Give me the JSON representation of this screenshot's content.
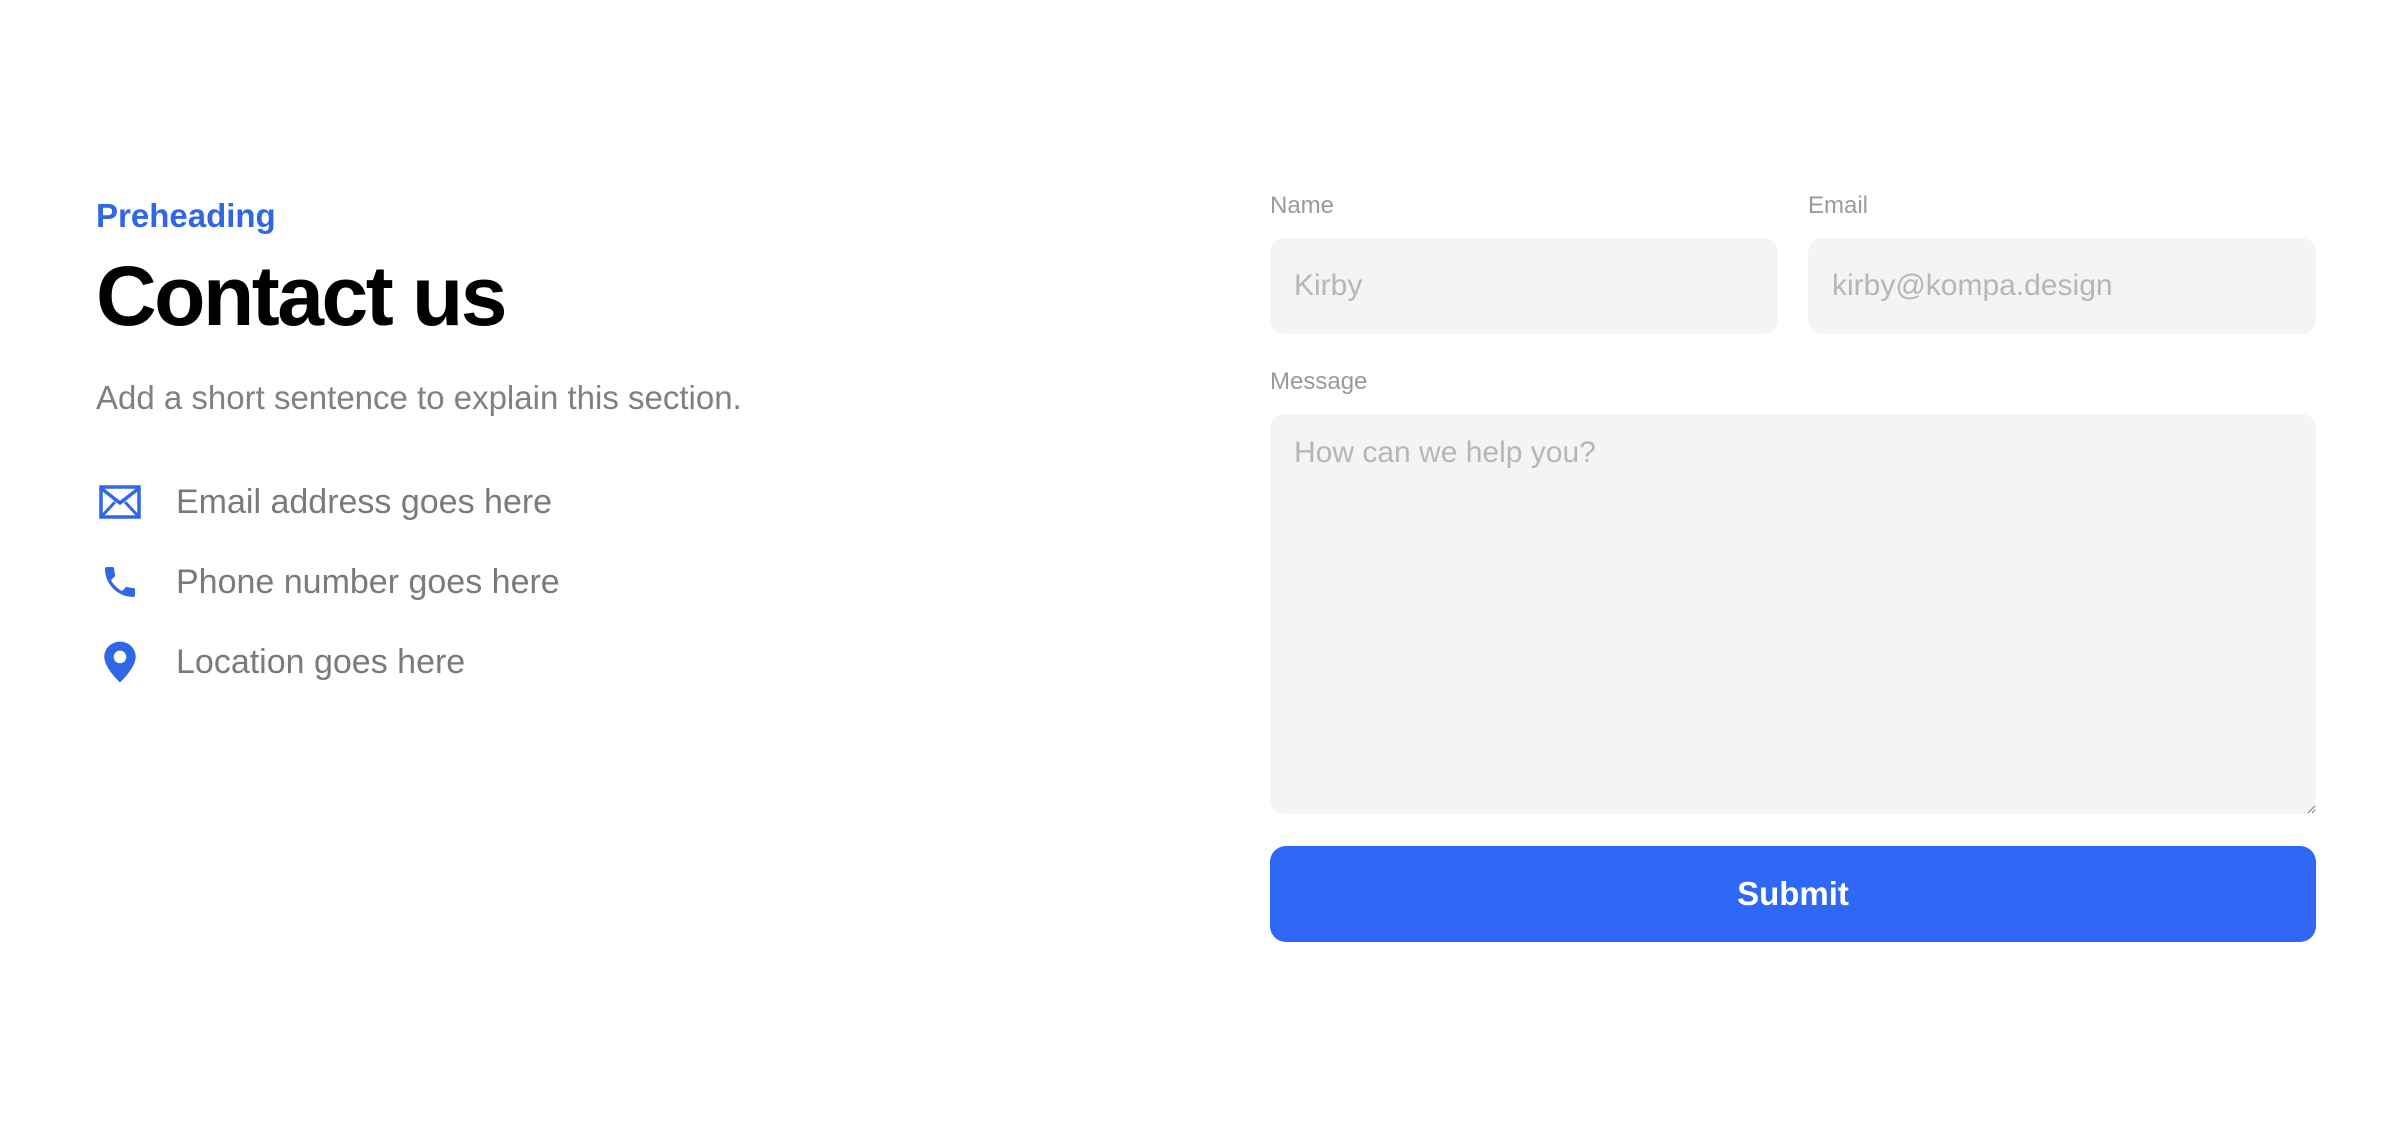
{
  "intro": {
    "preheading": "Preheading",
    "title": "Contact us",
    "subtitle": "Add a short sentence to explain this section."
  },
  "contact_items": [
    {
      "icon": "envelope-icon",
      "text": "Email address goes here"
    },
    {
      "icon": "phone-icon",
      "text": "Phone number goes here"
    },
    {
      "icon": "location-pin-icon",
      "text": "Location goes here"
    }
  ],
  "form": {
    "name": {
      "label": "Name",
      "value": "",
      "placeholder": "Kirby"
    },
    "email": {
      "label": "Email",
      "value": "",
      "placeholder": "kirby@kompa.design"
    },
    "message": {
      "label": "Message",
      "value": "",
      "placeholder": "How can we help you?"
    },
    "submit_label": "Submit"
  },
  "colors": {
    "accent": "#2f67e6",
    "button": "#2f68f6",
    "input_bg": "#f4f4f4",
    "muted_text": "#808080"
  }
}
